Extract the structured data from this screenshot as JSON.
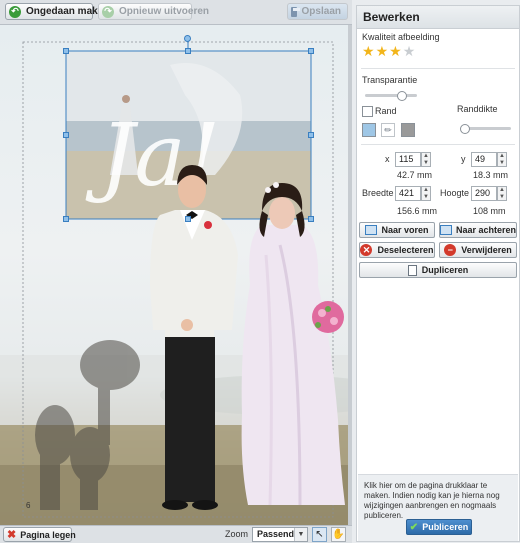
{
  "toolbar": {
    "undo_label": "Ongedaan maken",
    "redo_label": "Opnieuw uitvoeren",
    "save_label": "Opslaan"
  },
  "canvas": {
    "overlay_text": "Ja!",
    "page_number": "6"
  },
  "bottom": {
    "clear_page_label": "Pagina legen",
    "zoom_label": "Zoom",
    "zoom_value": "Passend"
  },
  "panel": {
    "title": "Bewerken",
    "quality_label": "Kwaliteit afbeelding",
    "quality_stars": 3,
    "quality_max": 4,
    "transparency_label": "Transparantie",
    "border_label": "Rand",
    "border_width_label": "Randdikte",
    "x_label": "x",
    "x_value": "115",
    "x_mm": "42.7 mm",
    "y_label": "y",
    "y_value": "49",
    "y_mm": "18.3 mm",
    "width_label": "Breedte",
    "width_value": "421",
    "width_mm": "156.6 mm",
    "height_label": "Hoogte",
    "height_value": "290",
    "height_mm": "108 mm",
    "front_label": "Naar voren",
    "back_label": "Naar achteren",
    "deselect_label": "Deselecteren",
    "delete_label": "Verwijderen",
    "duplicate_label": "Dupliceren",
    "publish_info": "Klik hier om de pagina drukklaar te maken. Indien nodig kan je hierna nog wijzigingen aanbrengen en nogmaals publiceren.",
    "publish_label": "Publiceren"
  }
}
